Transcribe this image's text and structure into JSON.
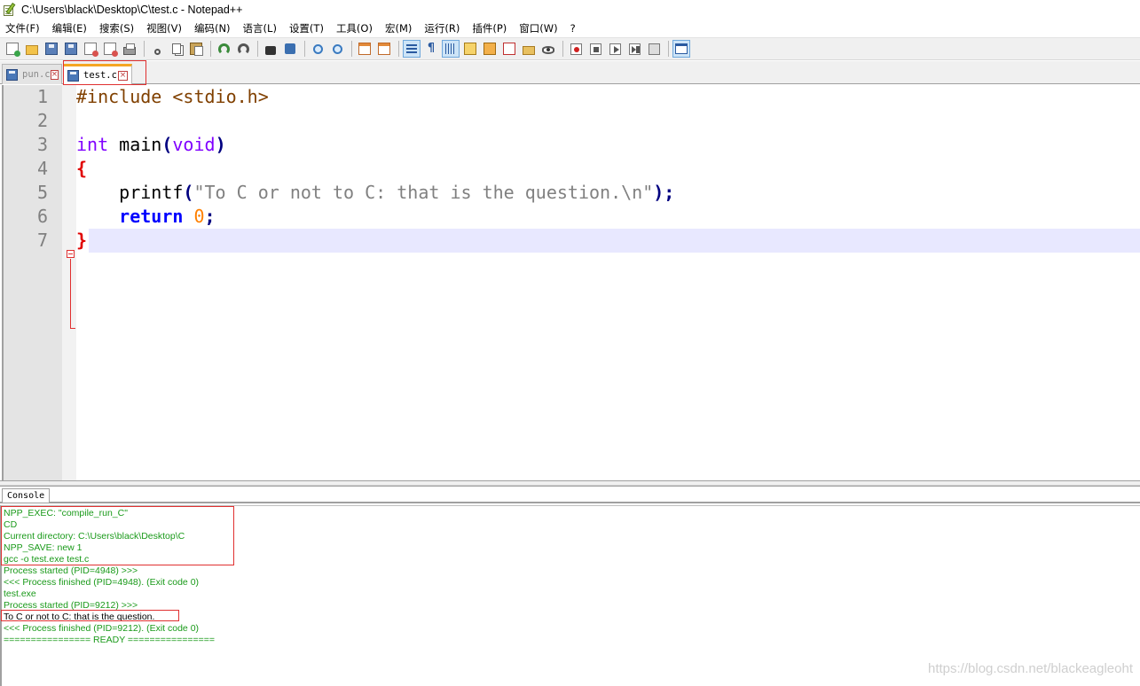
{
  "window": {
    "title": "C:\\Users\\black\\Desktop\\C\\test.c - Notepad++"
  },
  "menu": [
    {
      "label": "文件(F)"
    },
    {
      "label": "编辑(E)"
    },
    {
      "label": "搜索(S)"
    },
    {
      "label": "视图(V)"
    },
    {
      "label": "编码(N)"
    },
    {
      "label": "语言(L)"
    },
    {
      "label": "设置(T)"
    },
    {
      "label": "工具(O)"
    },
    {
      "label": "宏(M)"
    },
    {
      "label": "运行(R)"
    },
    {
      "label": "插件(P)"
    },
    {
      "label": "窗口(W)"
    },
    {
      "label": "?"
    }
  ],
  "tabs": [
    {
      "label": "pun.c",
      "active": false
    },
    {
      "label": "test.c",
      "active": true
    }
  ],
  "editor": {
    "line_numbers": [
      "1",
      "2",
      "3",
      "4",
      "5",
      "6",
      "7"
    ],
    "lines": {
      "l1_pre": "#include <stdio.h>",
      "l3_type": "int",
      "l3_name": " main",
      "l3_open": "(",
      "l3_void": "void",
      "l3_close": ")",
      "l4_brace": "{",
      "l5_indent": "    ",
      "l5_func": "printf",
      "l5_open": "(",
      "l5_str": "\"To C or not to C: that is the question.\\n\"",
      "l5_close": ");",
      "l6_indent": "    ",
      "l6_kw": "return",
      "l6_space": " ",
      "l6_num": "0",
      "l6_semi": ";",
      "l7_brace": "}"
    }
  },
  "console": {
    "title": "Console",
    "lines": [
      {
        "text": "NPP_EXEC: \"compile_run_C\"",
        "color": "green"
      },
      {
        "text": "CD",
        "color": "green"
      },
      {
        "text": "Current directory: C:\\Users\\black\\Desktop\\C",
        "color": "green"
      },
      {
        "text": "NPP_SAVE: new 1",
        "color": "green"
      },
      {
        "text": "gcc -o test.exe test.c",
        "color": "green"
      },
      {
        "text": "Process started (PID=4948) >>>",
        "color": "green"
      },
      {
        "text": "<<< Process finished (PID=4948). (Exit code 0)",
        "color": "green"
      },
      {
        "text": "test.exe",
        "color": "green"
      },
      {
        "text": "Process started (PID=9212) >>>",
        "color": "green"
      },
      {
        "text": "To C or not to C: that is the question.",
        "color": "black"
      },
      {
        "text": "<<< Process finished (PID=9212). (Exit code 0)",
        "color": "green"
      },
      {
        "text": "================ READY ================",
        "color": "green"
      }
    ]
  },
  "watermark": "https://blog.csdn.net/blackeagleoht",
  "colors": {
    "preprocessor": "#804000",
    "type": "#8000ff",
    "keyword": "#0000ff",
    "string": "#808080",
    "number": "#ff8000",
    "brace": "#e00000",
    "console_green": "#1a9a1a",
    "current_line": "#e8e8ff"
  }
}
